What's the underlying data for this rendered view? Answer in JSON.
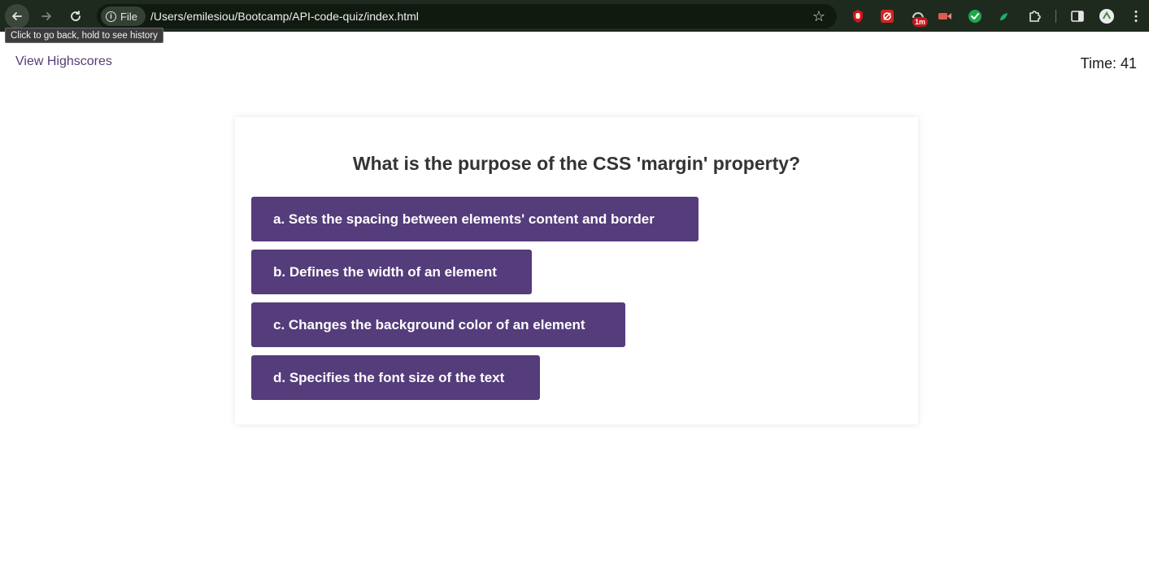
{
  "browser": {
    "scheme_chip_label": "File",
    "url": "/Users/emilesiou/Bootcamp/API-code-quiz/index.html",
    "tooltip": "Click to go back, hold to see history",
    "extension_badge": "1m",
    "icons": {
      "back": "arrow-left-icon",
      "forward": "arrow-right-icon",
      "reload": "reload-icon",
      "info": "info-icon",
      "bookmark": "star-icon",
      "extensions": "puzzle-icon",
      "side_panel": "side-panel-icon",
      "profile": "avatar",
      "menu": "kebab-menu-icon"
    }
  },
  "page": {
    "highscores_link": "View Highscores",
    "timer": "Time: 41"
  },
  "quiz": {
    "question": "What is the purpose of the CSS 'margin' property?",
    "answers": [
      "a. Sets the spacing between elements' content and border",
      "b. Defines the width of an element",
      "c. Changes the background color of an element",
      "d. Specifies the font size of the text"
    ]
  },
  "colors": {
    "accent": "#553c7b",
    "toolbar_bg": "#1f2a1f",
    "text_dark": "#333333"
  }
}
